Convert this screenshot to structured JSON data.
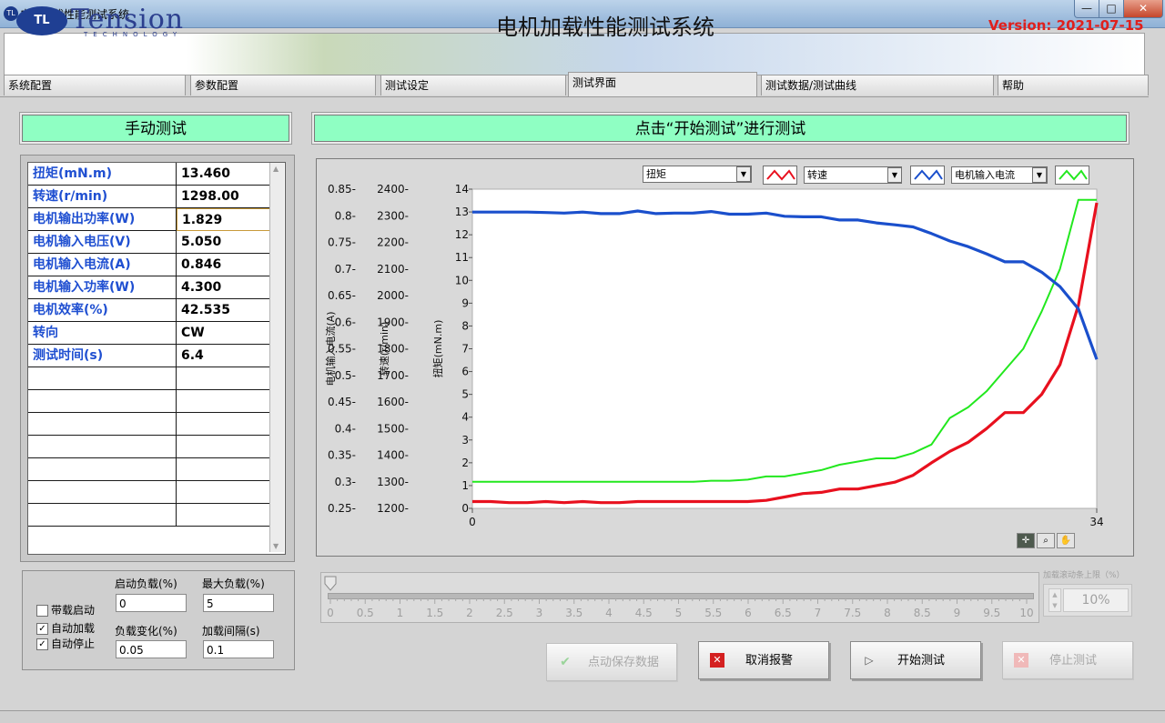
{
  "window": {
    "title": "电机加载性能测试系统",
    "app_icon": "logo-icon",
    "min": "—",
    "max": "□",
    "close": "✕"
  },
  "header": {
    "logo_name": "Tension",
    "logo_sub": "TECHNOLOGY",
    "logo_mark": "TL",
    "title": "电机加载性能测试系统",
    "version": "Version: 2021-07-15"
  },
  "tabs": [
    {
      "label": "系统配置"
    },
    {
      "label": "参数配置"
    },
    {
      "label": "测试设定"
    },
    {
      "label": "测试界面"
    },
    {
      "label": "测试数据/测试曲线"
    },
    {
      "label": "帮助"
    }
  ],
  "manual": {
    "title": "手动测试",
    "rows": [
      {
        "name": "扭矩(mN.m)",
        "value": "13.460"
      },
      {
        "name": "转速(r/min)",
        "value": "1298.00"
      },
      {
        "name": "电机输出功率(W)",
        "value": "1.829"
      },
      {
        "name": "电机输入电压(V)",
        "value": "5.050"
      },
      {
        "name": "电机输入电流(A)",
        "value": "0.846"
      },
      {
        "name": "电机输入功率(W)",
        "value": "4.300"
      },
      {
        "name": "电机效率(%)",
        "value": "42.535"
      },
      {
        "name": "转向",
        "value": "CW"
      },
      {
        "name": "测试时间(s)",
        "value": "6.4"
      }
    ]
  },
  "config": {
    "cb_load_start": {
      "label": "带载启动",
      "checked": false
    },
    "cb_auto_load": {
      "label": "自动加载",
      "checked": true
    },
    "cb_auto_stop": {
      "label": "自动停止",
      "checked": true
    },
    "start_load_label": "启动负载(%)",
    "start_load_value": "0",
    "max_load_label": "最大负载(%)",
    "max_load_value": "5",
    "load_change_label": "负载变化(%)",
    "load_change_value": "0.05",
    "load_interval_label": "加载间隔(s)",
    "load_interval_value": "0.1"
  },
  "hint": "点击“开始测试”进行测试",
  "legend": {
    "torque": "扭矩",
    "speed": "转速",
    "current": "电机输入电流"
  },
  "colors": {
    "torque": "#e8101e",
    "speed": "#1a4fcc",
    "current": "#22e81e",
    "panel_green": "#8fffc3",
    "version_red": "#e0201c"
  },
  "chart_data": {
    "type": "line",
    "x": [
      0,
      1,
      2,
      3,
      4,
      5,
      6,
      7,
      8,
      9,
      10,
      11,
      12,
      13,
      14,
      15,
      16,
      17,
      18,
      19,
      20,
      21,
      22,
      23,
      24,
      25,
      26,
      27,
      28,
      29,
      30,
      31,
      32,
      33,
      34
    ],
    "xlim": [
      0,
      34
    ],
    "x_ticks": [
      "0",
      "34"
    ],
    "axes": [
      {
        "label": "扭矩(mN.m)",
        "ylim": [
          0,
          14
        ],
        "ticks": [
          "0",
          "1",
          "2",
          "3",
          "4",
          "5",
          "6",
          "7",
          "8",
          "9",
          "10",
          "11",
          "12",
          "13",
          "14"
        ]
      },
      {
        "label": "转速(r/min)",
        "ylim": [
          1200,
          2400
        ],
        "ticks": [
          "1200-",
          "1300-",
          "1400-",
          "1500-",
          "1600-",
          "1700-",
          "1800-",
          "1900-",
          "2000-",
          "2100-",
          "2200-",
          "2300-",
          "2400-"
        ]
      },
      {
        "label": "电机输入电流(A)",
        "ylim": [
          0.25,
          0.85
        ],
        "ticks": [
          "0.25-",
          "0.3-",
          "0.35-",
          "0.4-",
          "0.45-",
          "0.5-",
          "0.55-",
          "0.6-",
          "0.65-",
          "0.7-",
          "0.75-",
          "0.8-",
          "0.85-"
        ]
      }
    ],
    "series": [
      {
        "name": "扭矩",
        "axis": 0,
        "values": [
          0.3,
          0.3,
          0.25,
          0.25,
          0.3,
          0.25,
          0.3,
          0.25,
          0.25,
          0.3,
          0.3,
          0.3,
          0.3,
          0.3,
          0.3,
          0.3,
          0.35,
          0.5,
          0.65,
          0.7,
          0.85,
          0.85,
          1.0,
          1.15,
          1.45,
          2.0,
          2.5,
          2.9,
          3.5,
          4.2,
          4.2,
          5.0,
          6.3,
          8.9,
          13.4
        ]
      },
      {
        "name": "转速",
        "axis": 1,
        "values": [
          2314,
          2314,
          2314,
          2314,
          2312,
          2310,
          2314,
          2308,
          2308,
          2318,
          2308,
          2310,
          2310,
          2316,
          2306,
          2306,
          2310,
          2298,
          2296,
          2296,
          2284,
          2284,
          2273,
          2266,
          2258,
          2233,
          2205,
          2184,
          2157,
          2127,
          2127,
          2088,
          2034,
          1950,
          1760
        ]
      },
      {
        "name": "电机输入电流",
        "axis": 2,
        "values": [
          0.3,
          0.3,
          0.3,
          0.3,
          0.3,
          0.3,
          0.3,
          0.3,
          0.3,
          0.3,
          0.3,
          0.3,
          0.3,
          0.302,
          0.302,
          0.304,
          0.31,
          0.31,
          0.316,
          0.322,
          0.332,
          0.338,
          0.344,
          0.344,
          0.354,
          0.37,
          0.42,
          0.44,
          0.47,
          0.51,
          0.55,
          0.62,
          0.7,
          0.83,
          0.83
        ]
      }
    ]
  },
  "slider": {
    "ticks": [
      "0",
      "0.5",
      "1",
      "1.5",
      "2",
      "2.5",
      "3",
      "3.5",
      "4",
      "4.5",
      "5",
      "5.5",
      "6",
      "6.5",
      "7",
      "7.5",
      "8",
      "8.5",
      "9",
      "9.5",
      "10"
    ],
    "value": 0
  },
  "limit": {
    "label": "加载滚动条上限（%）",
    "value": "10%"
  },
  "buttons": {
    "save_manual": "点动保存数据",
    "cancel_alarm": "取消报警",
    "start_test": "开始测试",
    "stop_test": "停止测试"
  }
}
